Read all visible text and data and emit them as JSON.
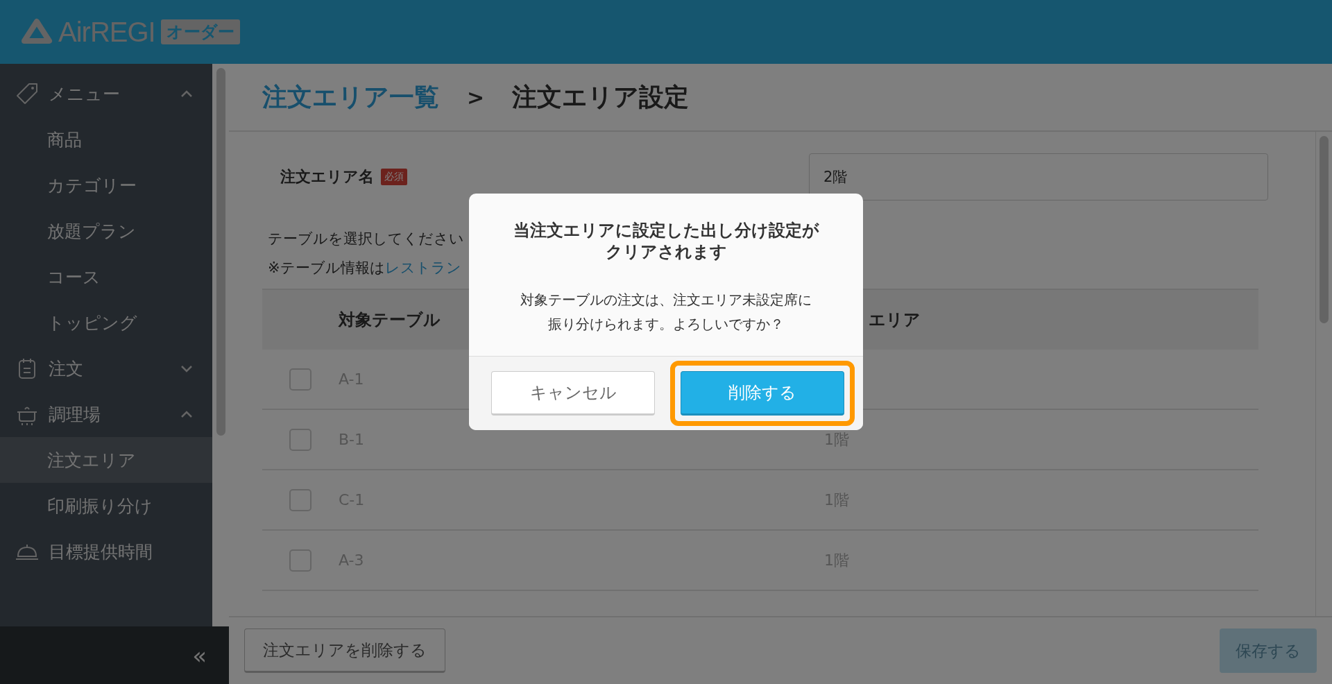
{
  "header": {
    "logo_text": "AirREGI",
    "logo_badge": "オーダー"
  },
  "sidebar": {
    "groups": [
      {
        "label": "メニュー",
        "expanded": true,
        "children": [
          {
            "label": "商品",
            "selected": false
          },
          {
            "label": "カテゴリー",
            "selected": false
          },
          {
            "label": "放題プラン",
            "selected": false
          },
          {
            "label": "コース",
            "selected": false
          },
          {
            "label": "トッピング",
            "selected": false
          }
        ]
      },
      {
        "label": "注文",
        "expanded": false
      },
      {
        "label": "調理場",
        "expanded": true,
        "children": [
          {
            "label": "注文エリア",
            "selected": true
          },
          {
            "label": "印刷振り分け",
            "selected": false
          }
        ]
      },
      {
        "label": "目標提供時間"
      }
    ],
    "collapse_label": "«"
  },
  "breadcrumb": {
    "parent": "注文エリア一覧",
    "separator": ">",
    "current": "注文エリア設定"
  },
  "form": {
    "name_label": "注文エリア名",
    "required_badge": "必須",
    "name_value": "2階",
    "instruction": "テーブルを選択してください",
    "note_prefix": "※テーブル情報は",
    "note_link": "レストラン"
  },
  "table": {
    "columns": [
      "対象テーブル",
      "エリア"
    ],
    "rows": [
      {
        "checked": false,
        "cells": [
          "A-1"
        ]
      },
      {
        "checked": false,
        "cells": [
          "B-1",
          "1階"
        ]
      },
      {
        "checked": false,
        "cells": [
          "C-1",
          "1階"
        ]
      },
      {
        "checked": false,
        "cells": [
          "A-3",
          "1階"
        ]
      }
    ]
  },
  "footer": {
    "delete_button": "注文エリアを削除する",
    "save_button": "保存する",
    "save_disabled": true
  },
  "dialog": {
    "title_lines": [
      "当注文エリアに設定した出し分け設定が",
      "クリアされます"
    ],
    "message_lines": [
      "対象テーブルの注文は、注文エリア未設定席に",
      "振り分けられます。よろしいですか？"
    ],
    "cancel_button": "キャンセル",
    "confirm_button": "削除する",
    "confirm_highlighted": true
  }
}
